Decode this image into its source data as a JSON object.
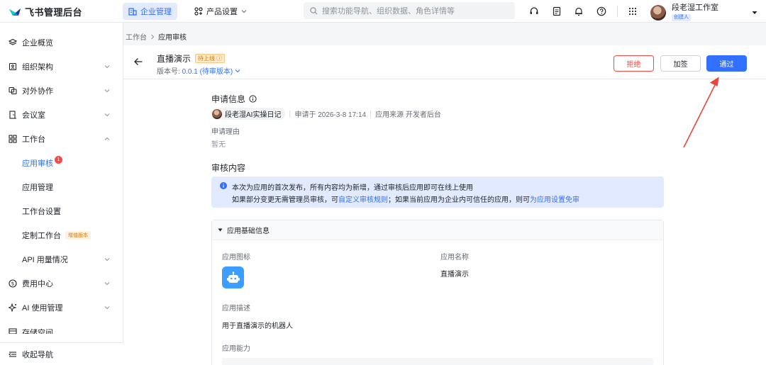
{
  "brand": {
    "name": "飞书管理后台"
  },
  "top_nav": {
    "tabs": [
      {
        "label": "企业管理",
        "active": true
      },
      {
        "label": "产品设置",
        "active": false
      }
    ],
    "search_placeholder": "搜索功能导航、组织数据、角色详情等",
    "user": {
      "name": "段老湿工作室",
      "role_tag": "创建人"
    }
  },
  "sidebar": {
    "items": [
      {
        "label": "企业概览",
        "icon": "layers-icon"
      },
      {
        "label": "组织架构",
        "icon": "org-icon"
      },
      {
        "label": "对外协作",
        "icon": "collab-icon"
      },
      {
        "label": "会议室",
        "icon": "meeting-room-icon"
      },
      {
        "label": "工作台",
        "icon": "grid-icon"
      },
      {
        "label": "应用审核",
        "badge": "1",
        "active": true
      },
      {
        "label": "应用管理"
      },
      {
        "label": "工作台设置"
      },
      {
        "label": "定制工作台",
        "tag": "增值版本"
      },
      {
        "label": "API 用量情况"
      },
      {
        "label": "费用中心",
        "icon": "dollar-icon"
      },
      {
        "label": "AI 使用管理",
        "icon": "ai-spark-icon"
      },
      {
        "label": "存储空间",
        "icon": "storage-icon"
      }
    ],
    "collapse_label": "收起导航"
  },
  "breadcrumb": {
    "root": "工作台",
    "current": "应用审核"
  },
  "header": {
    "app_name": "直播演示",
    "status": "待上线",
    "version_label": "版本号:",
    "version_value": "0.0.1 (待审版本)",
    "reject_label": "拒绝",
    "sign_label": "加签",
    "approve_label": "通过"
  },
  "request_info": {
    "title": "申请信息",
    "applicant": "段老湿AI实操日记",
    "applied_at": "申请于 2026-3-8 17:14",
    "source": "应用来源 开发者后台",
    "reason_label": "申请理由",
    "reason_value": "暂无"
  },
  "review": {
    "title": "审核内容",
    "notice_line1": "本次为应用的首次发布，所有内容均为新增，通过审核后应用即可在线上使用",
    "notice_line2_a": "如果部分变更无需管理员审核，可",
    "notice_link1": "自定义审核规则",
    "notice_line2_b": "；如果当前应用为企业内可信任的应用，则可",
    "notice_link2": "为应用设置免审"
  },
  "app_basic": {
    "section_title": "应用基础信息",
    "icon_label": "应用图标",
    "name_label": "应用名称",
    "name_value": "直播演示",
    "desc_label": "应用描述",
    "desc_value": "用于直播演示的机器人",
    "ability_label": "应用能力"
  },
  "colors": {
    "accent": "#3370ff",
    "danger": "#f54a45",
    "warning": "#de7802",
    "annotation": "#e8453c"
  }
}
